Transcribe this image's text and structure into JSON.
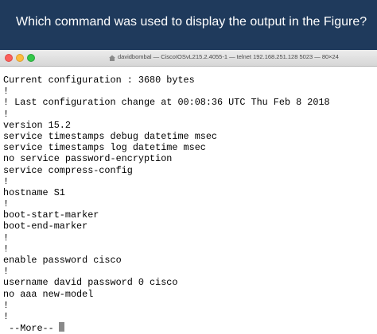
{
  "question": "Which command was used to display the output in the Figure?",
  "window": {
    "title": "davidbombal — CiscoIOSvL215.2.4055-1 — telnet 192.168.251.128 5023 — 80×24"
  },
  "terminal": {
    "lines": [
      "Current configuration : 3680 bytes",
      "!",
      "! Last configuration change at 00:08:36 UTC Thu Feb 8 2018",
      "!",
      "version 15.2",
      "service timestamps debug datetime msec",
      "service timestamps log datetime msec",
      "no service password-encryption",
      "service compress-config",
      "!",
      "hostname S1",
      "!",
      "boot-start-marker",
      "boot-end-marker",
      "!",
      "!",
      "enable password cisco",
      "!",
      "username david password 0 cisco",
      "no aaa new-model",
      "!",
      "!"
    ],
    "more_prompt": " --More--"
  }
}
